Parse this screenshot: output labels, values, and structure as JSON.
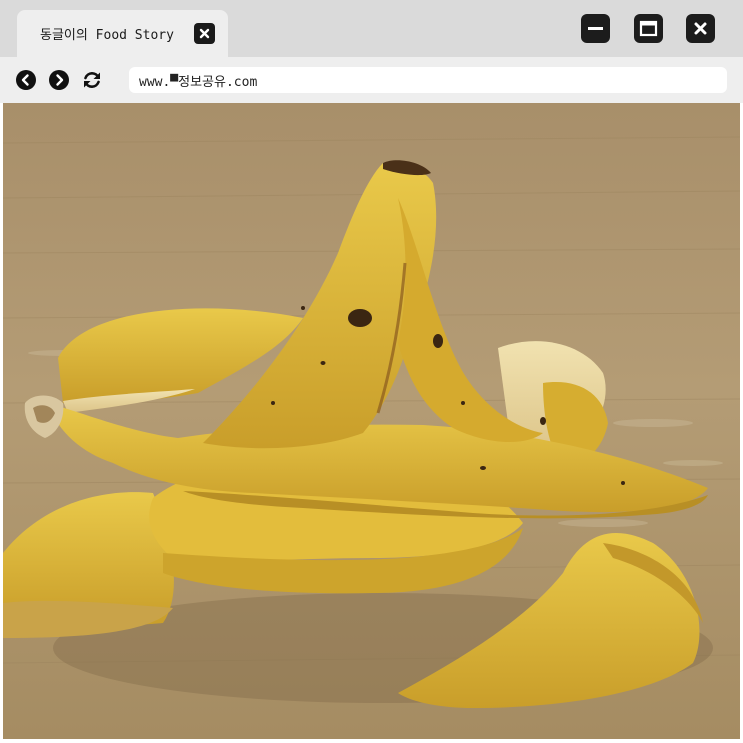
{
  "tab": {
    "title": "동글이의 Food Story",
    "close_icon": "close-icon"
  },
  "window_controls": {
    "minimize_icon": "minimize-icon",
    "maximize_icon": "maximize-icon",
    "close_icon": "close-icon"
  },
  "toolbar": {
    "back_icon": "chevron-left-icon",
    "forward_icon": "chevron-right-icon",
    "reload_icon": "reload-icon",
    "url": "www.▀정보공유.com"
  },
  "content": {
    "image": "banana-peel-photo"
  },
  "colors": {
    "titlebar_bg": "#dadada",
    "tab_bg": "#eeeeee",
    "control_bg": "#1c1c1c",
    "peel_yellow": "#e0be3a",
    "table_wood": "#b39a72"
  }
}
